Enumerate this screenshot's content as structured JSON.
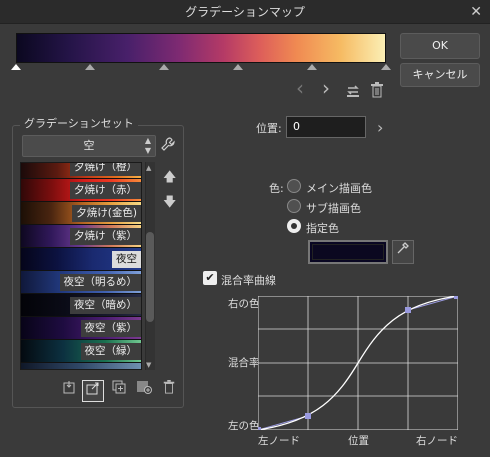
{
  "window": {
    "title": "グラデーションマップ",
    "close": "✕"
  },
  "gradient": {
    "stops": [
      0,
      20,
      40,
      60,
      80,
      100
    ],
    "selected_stop": 0
  },
  "buttons": {
    "ok": "OK",
    "cancel": "キャンセル"
  },
  "nav": {
    "prev": "‹",
    "next": "›"
  },
  "gradient_set": {
    "title": "グラデーションセット",
    "selected_set": "空",
    "items": [
      {
        "label": "夕焼け（橙）",
        "gradient": "linear-gradient(to right,#1b0a0a,#5a1a10 30%,#c03a18 55%,#e27020 80%,#f6b048)"
      },
      {
        "label": "夕焼け（赤）",
        "gradient": "linear-gradient(to right,#300808,#7a0e0e 25%,#d01a1a 50%,#ee3a22 75%,#f88a3a)"
      },
      {
        "label": "夕焼け(金色)",
        "gradient": "linear-gradient(to right,#1c0f06,#4a2510 25%,#b06020 50%,#e6a040 75%,#f6dc88)"
      },
      {
        "label": "夕焼け（紫）",
        "gradient": "linear-gradient(to right,#0e0820,#30185a 25%,#6a3a90 50%,#d27a5a 75%,#f6d282)"
      },
      {
        "label": "夜空",
        "gradient": "linear-gradient(to right,#05051a,#0c1240 30%,#1a2a70 60%,#243c8c)"
      },
      {
        "label": "夜空（明るめ）",
        "gradient": "linear-gradient(to right,#10183a,#223a80 35%,#4060b0 70%,#7fa0d8)"
      },
      {
        "label": "夜空（暗め）",
        "gradient": "linear-gradient(to right,#030308,#0b0c18 40%,#1a1c30 80%,#262a44)"
      },
      {
        "label": "夜空（紫）",
        "gradient": "linear-gradient(to right,#080418,#1e0c40 35%,#4a1c70 70%,#7a3a90)"
      },
      {
        "label": "夜空（緑）",
        "gradient": "linear-gradient(to right,#040a10,#0c3040 35%,#1a7050 70%,#70c890)"
      },
      {
        "label": "",
        "gradient": "linear-gradient(to right,#101828,#304868 50%,#7090b0)"
      }
    ],
    "selected_index": 4
  },
  "position": {
    "label": "位置:",
    "value": "0"
  },
  "color": {
    "label": "色:",
    "options": [
      "メイン描画色",
      "サブ描画色",
      "指定色"
    ],
    "selected": 2,
    "swatch": "#0b0820"
  },
  "curve": {
    "checkbox_label": "混合率曲線",
    "checked": true,
    "y_labels": {
      "top": "右の色",
      "middle": "混合率",
      "bottom": "左の色"
    },
    "x_labels": {
      "left": "左ノード",
      "middle": "位置",
      "right": "右ノード"
    }
  }
}
